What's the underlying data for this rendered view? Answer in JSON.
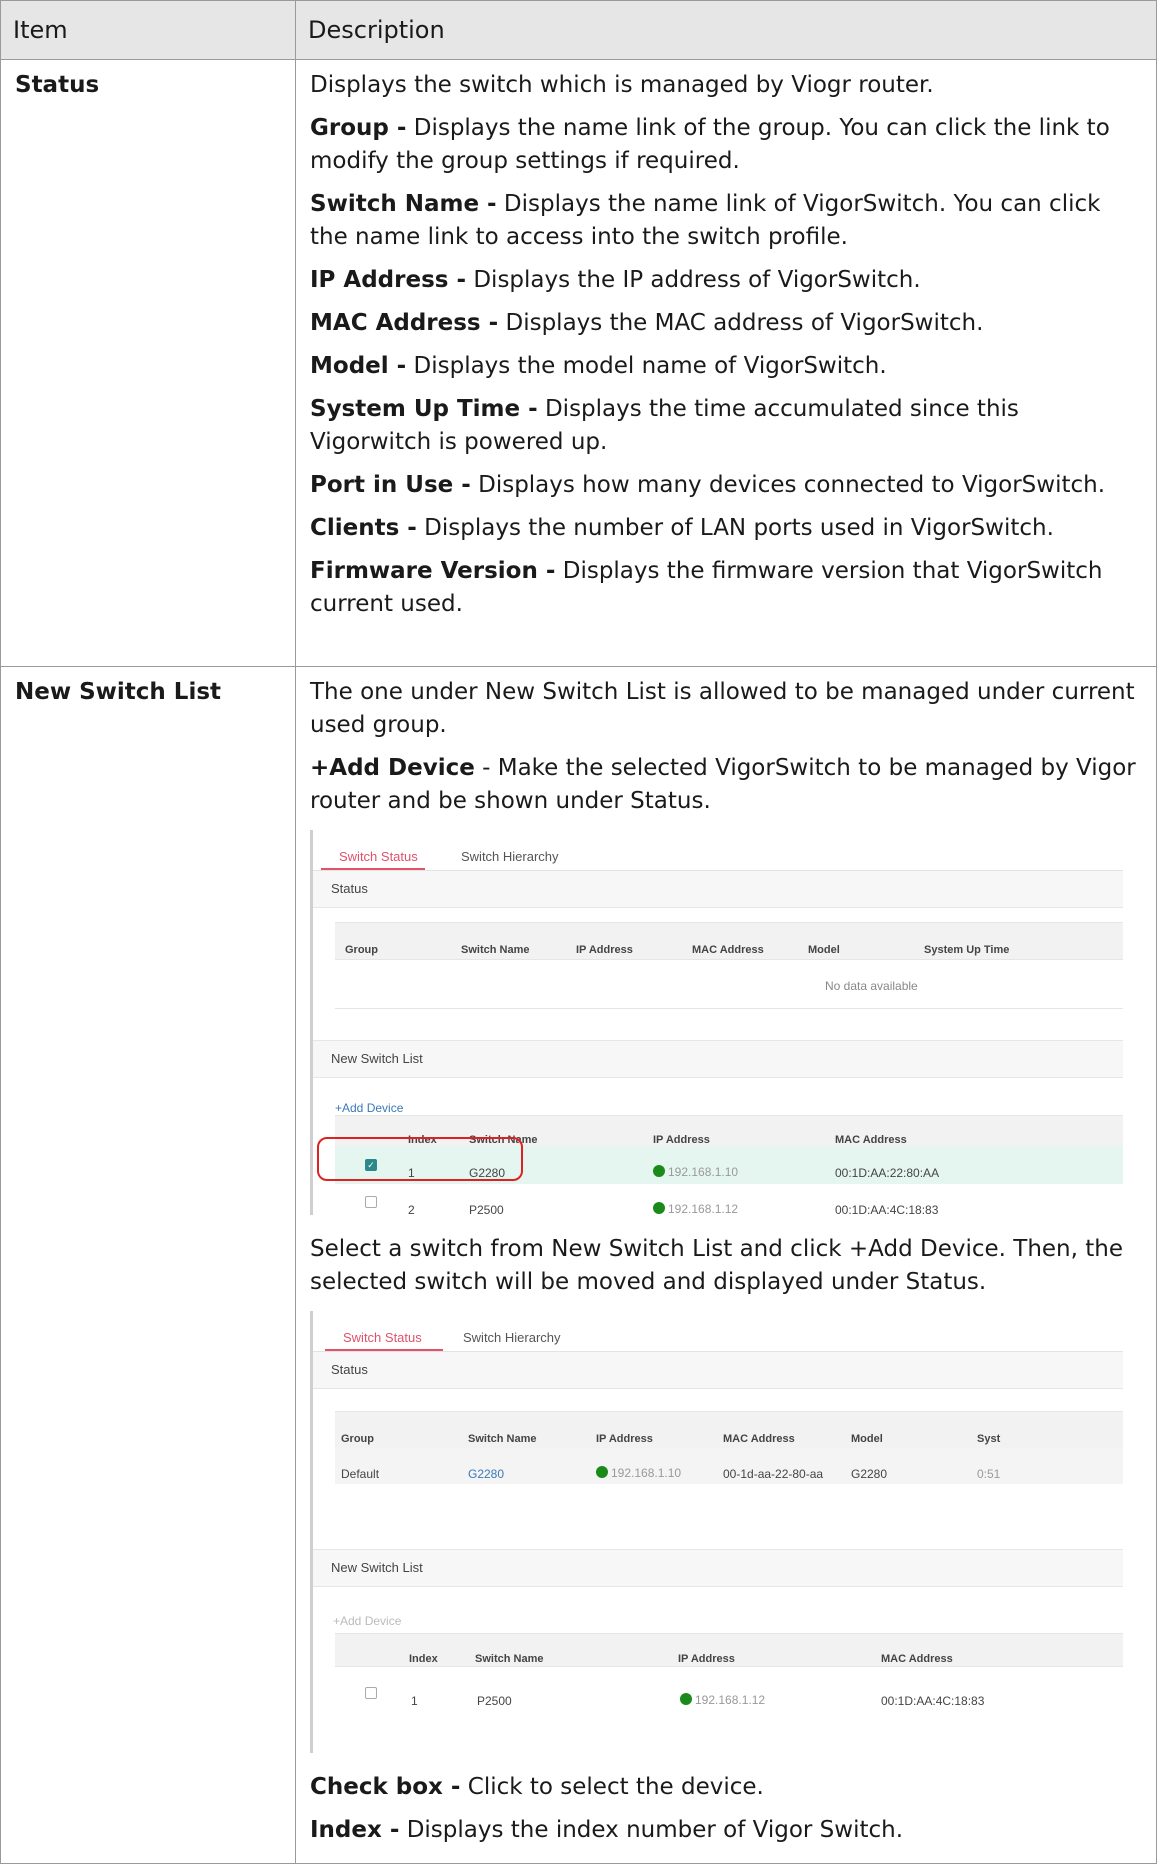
{
  "table": {
    "headers": {
      "item": "Item",
      "description": "Description"
    },
    "status_row": {
      "item": "Status",
      "intro": "Displays the switch which is managed by Viogr router.",
      "fields": [
        {
          "label": "Group -",
          "text": " Displays the name link of the group. You can click the link to modify the group settings if required."
        },
        {
          "label": "Switch Name -",
          "text": " Displays the name link of VigorSwitch. You can click the name link to access into the switch profile."
        },
        {
          "label": "IP Address -",
          "text": " Displays the IP address of VigorSwitch."
        },
        {
          "label": "MAC Address -",
          "text": " Displays the MAC address of VigorSwitch."
        },
        {
          "label": "Model -",
          "text": " Displays the model name of VigorSwitch."
        },
        {
          "label": "System Up Time -",
          "text": " Displays the time accumulated since this Vigorwitch is powered up."
        },
        {
          "label": "Port in Use -",
          "text": " Displays how many devices connected to VigorSwitch."
        },
        {
          "label": "Clients -",
          "text": " Displays the number of LAN ports used in VigorSwitch."
        },
        {
          "label": "Firmware Version -",
          "text": " Displays the firmware version that VigorSwitch current used."
        }
      ]
    },
    "new_switch_row": {
      "item": "New Switch List",
      "intro": "The one under New Switch List is allowed to be managed under current used group.",
      "add_device_label": "+Add Device",
      "add_device_text": " - Make the selected VigorSwitch to be managed by Vigor router and be shown under Status.",
      "middle_text": "Select a switch from New Switch List and click +Add Device. Then, the selected switch will be moved and displayed under Status.",
      "fields": [
        {
          "label": "Check box -",
          "text": " Click to select the device."
        },
        {
          "label": "Index -",
          "text": " Displays the index number of Vigor Switch."
        }
      ]
    }
  },
  "shot1": {
    "tabs": [
      "Switch Status",
      "Switch Hierarchy"
    ],
    "status_title": "Status",
    "status_headers": [
      "Group",
      "Switch Name",
      "IP Address",
      "MAC Address",
      "Model",
      "System Up Time"
    ],
    "no_data": "No data available",
    "new_list_title": "New Switch List",
    "add_device": "+Add Device",
    "list_headers": [
      "Index",
      "Switch Name",
      "IP Address",
      "MAC Address"
    ],
    "rows": [
      {
        "checked": true,
        "index": "1",
        "name": "G2280",
        "ip": "192.168.1.10",
        "mac": "00:1D:AA:22:80:AA"
      },
      {
        "checked": false,
        "index": "2",
        "name": "P2500",
        "ip": "192.168.1.12",
        "mac": "00:1D:AA:4C:18:83"
      }
    ]
  },
  "shot2": {
    "tabs": [
      "Switch Status",
      "Switch Hierarchy"
    ],
    "status_title": "Status",
    "status_headers": [
      "Group",
      "Switch Name",
      "IP Address",
      "MAC Address",
      "Model",
      "Syst"
    ],
    "status_row": {
      "group": "Default",
      "name": "G2280",
      "ip": "192.168.1.10",
      "mac": "00-1d-aa-22-80-aa",
      "model": "G2280",
      "uptime": "0:51"
    },
    "new_list_title": "New Switch List",
    "add_device": "+Add Device",
    "list_headers": [
      "Index",
      "Switch Name",
      "IP Address",
      "MAC Address"
    ],
    "rows": [
      {
        "checked": false,
        "index": "1",
        "name": "P2500",
        "ip": "192.168.1.12",
        "mac": "00:1D:AA:4C:18:83"
      }
    ]
  }
}
